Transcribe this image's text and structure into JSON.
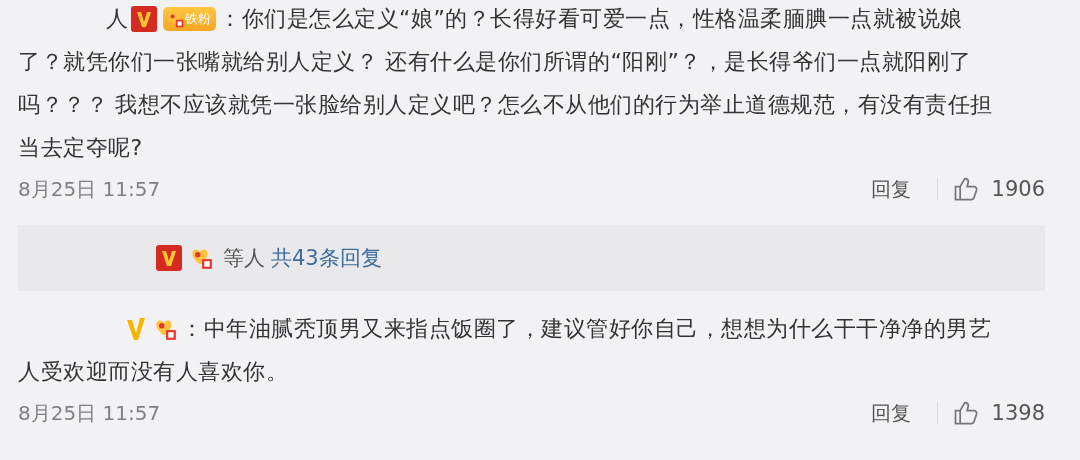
{
  "comments": [
    {
      "username": "人",
      "badges": [
        {
          "kind": "verified-red"
        },
        {
          "kind": "fan-label",
          "label": "铁粉"
        }
      ],
      "lines": [
        "：你们是怎么定义“娘”的？长得好看可爱一点，性格温柔腼腆一点就被说娘",
        "了？就凭你们一张嘴就给别人定义？ 还有什么是你们所谓的“阳刚”？，是长得爷们一点就阳刚了",
        "吗？？？ 我想不应该就凭一张脸给别人定义吧？怎么不从他们的行为举止道德规范，有没有责任担",
        "当去定夺呢?"
      ],
      "date": "8月25日 11:57",
      "reply": "回复",
      "likes": "1906",
      "replies_summary": {
        "badges": [
          {
            "kind": "verified-red"
          },
          {
            "kind": "fan"
          }
        ],
        "suffix": "等人",
        "link": "共43条回复"
      }
    },
    {
      "badges": [
        {
          "kind": "verified-yellow"
        },
        {
          "kind": "fan"
        }
      ],
      "lines": [
        "：中年油腻秃顶男又来指点饭圈了，建议管好你自己，想想为什么干干净净的男艺",
        "人受欢迎而没有人喜欢你。"
      ],
      "date": "8月25日 11:57",
      "reply": "回复",
      "likes": "1398"
    }
  ]
}
